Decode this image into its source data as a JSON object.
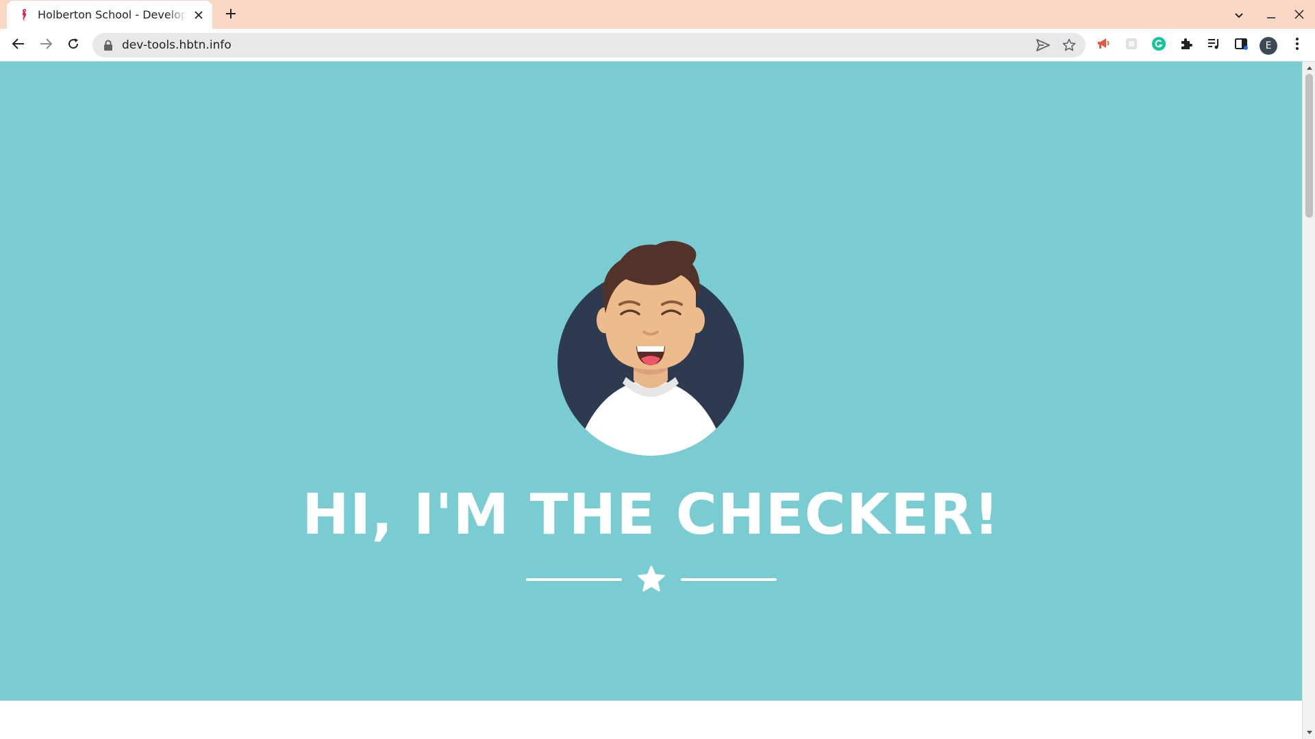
{
  "browser": {
    "tab": {
      "title": "Holberton School - Developer Tools",
      "favicon": "holberton-seahorse-icon"
    },
    "address_bar": {
      "url": "dev-tools.hbtn.info",
      "security": "lock-icon"
    },
    "profile_initial": "E",
    "theme_color": "#fbd8c6"
  },
  "page": {
    "hero": {
      "title": "HI, I'M THE CHECKER!",
      "background_color": "#78ccd2",
      "avatar": "smiling-man-avatar",
      "divider_icon": "star-icon"
    }
  }
}
